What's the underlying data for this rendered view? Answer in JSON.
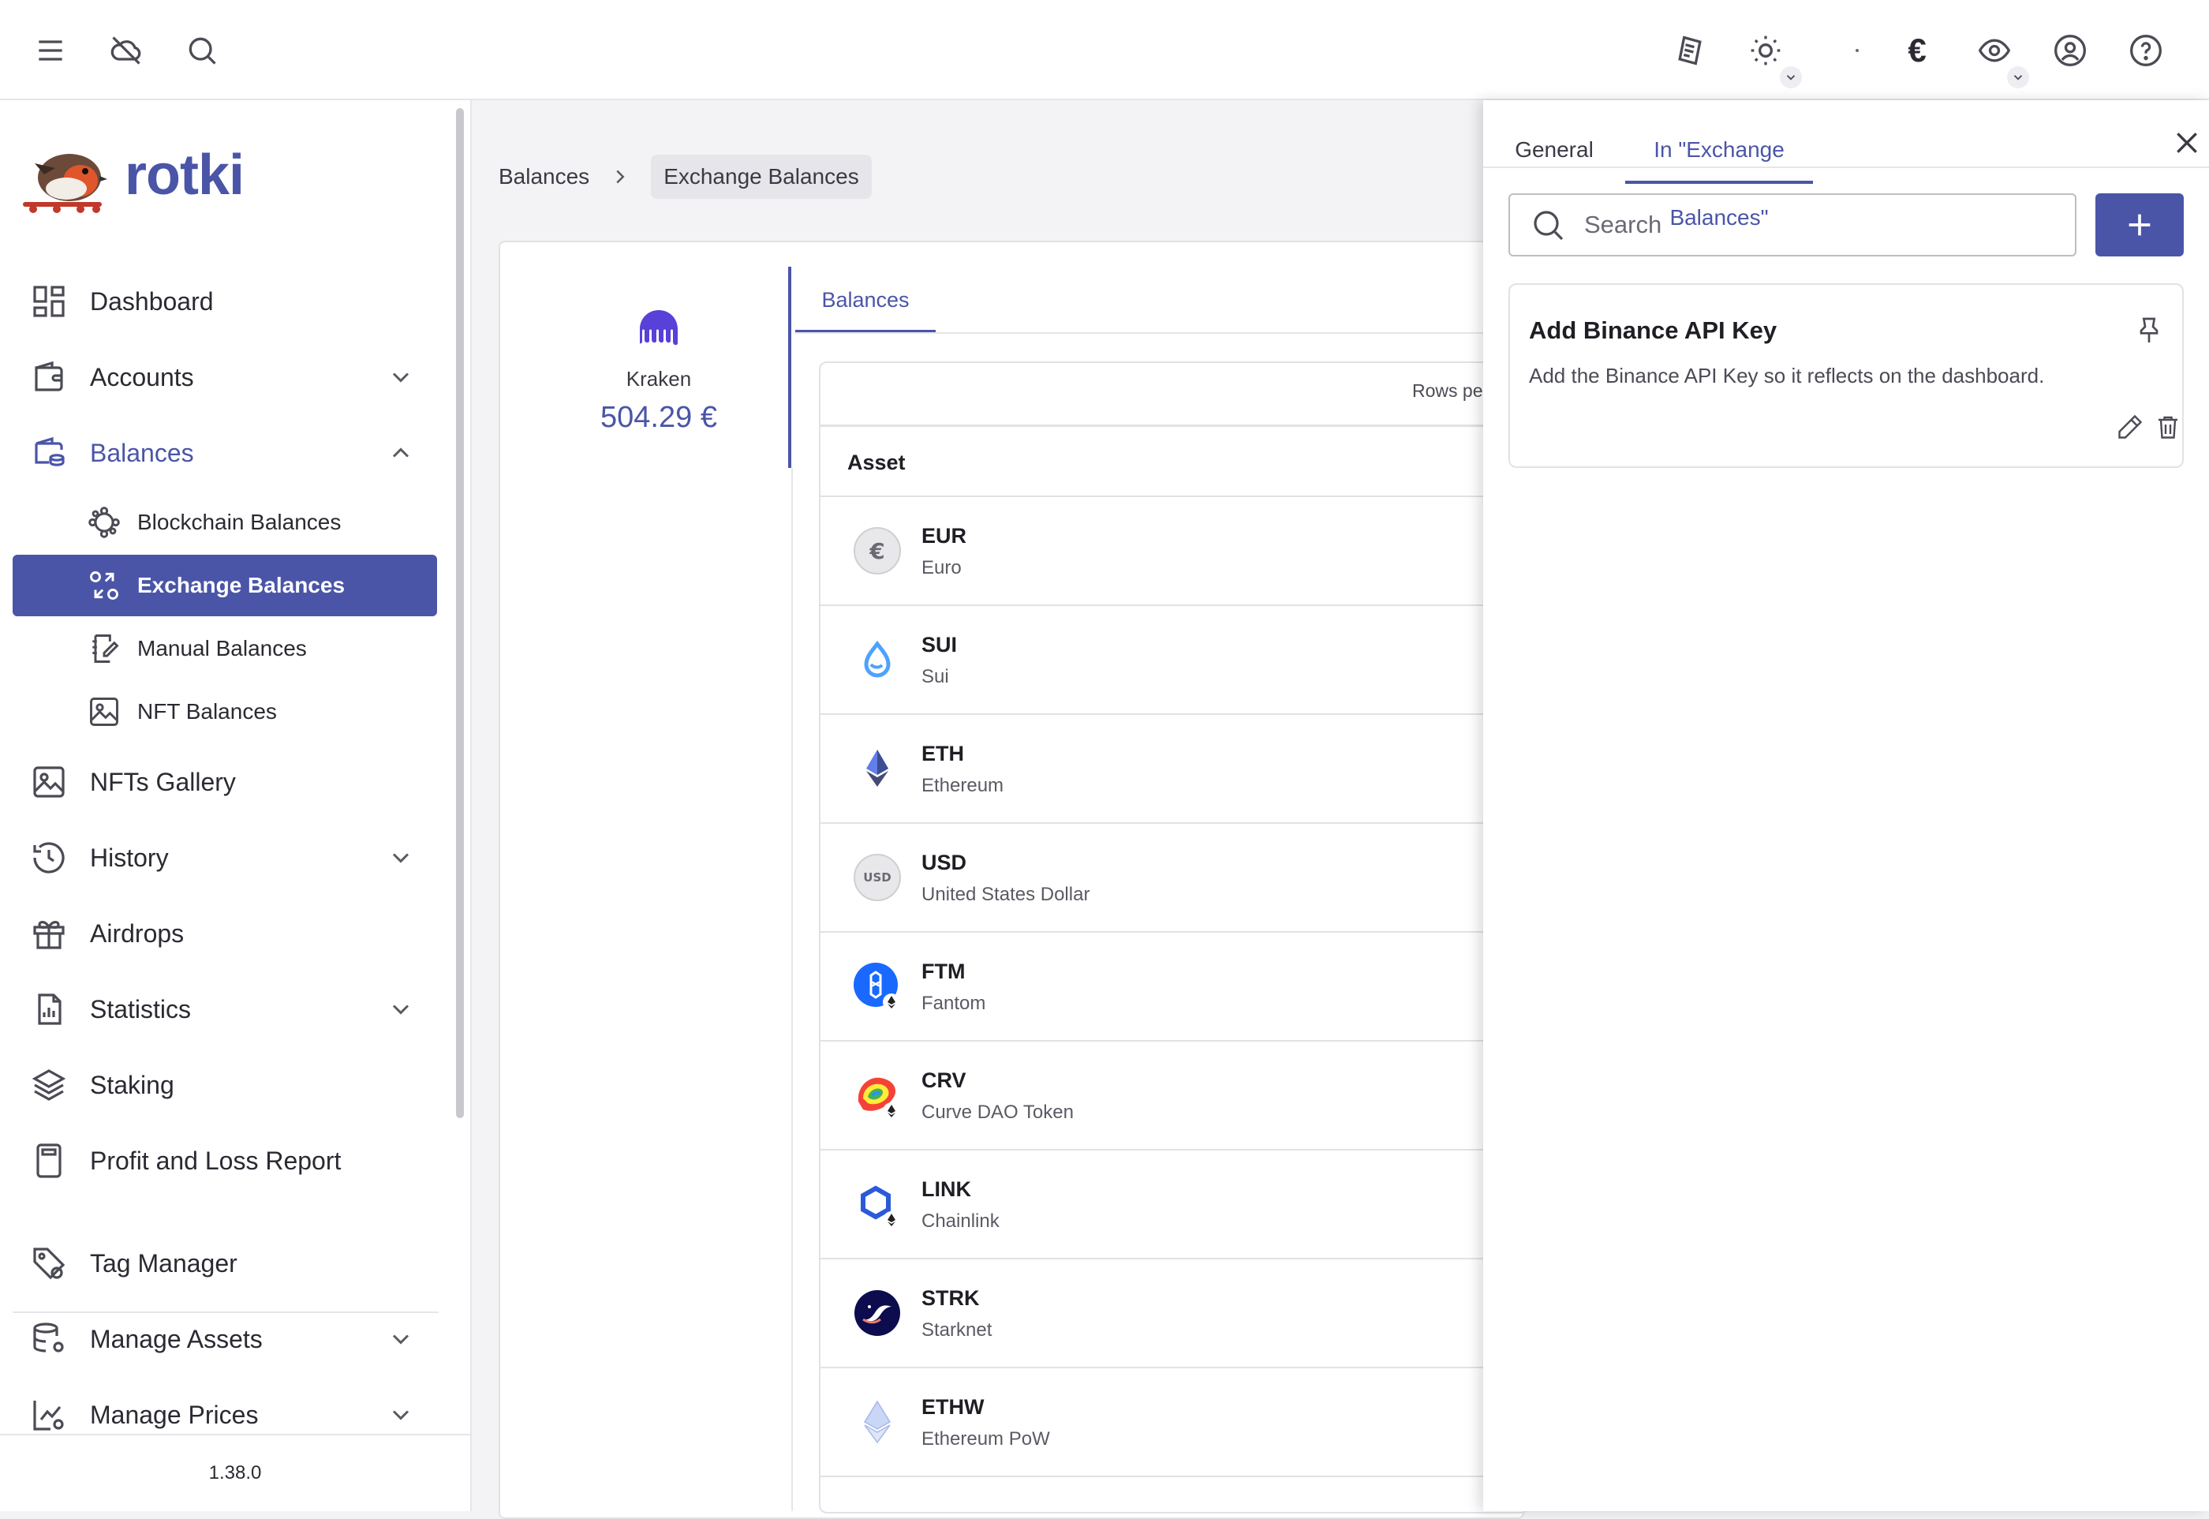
{
  "topbar": {
    "icons": [
      "menu-icon",
      "cloud-off-icon",
      "search-icon",
      "notes-icon",
      "sun-icon",
      "dot-indicator",
      "euro-icon",
      "eye-icon",
      "account-circle-icon",
      "help-icon"
    ],
    "currency_symbol": "€"
  },
  "sidebar": {
    "brand": "rotki",
    "items": [
      {
        "label": "Dashboard"
      },
      {
        "label": "Accounts"
      },
      {
        "label": "Balances"
      },
      {
        "label": "Blockchain Balances"
      },
      {
        "label": "Exchange Balances"
      },
      {
        "label": "Manual Balances"
      },
      {
        "label": "NFT Balances"
      },
      {
        "label": "NFTs Gallery"
      },
      {
        "label": "History"
      },
      {
        "label": "Airdrops"
      },
      {
        "label": "Statistics"
      },
      {
        "label": "Staking"
      },
      {
        "label": "Profit and Loss Report"
      },
      {
        "label": "Tag Manager"
      },
      {
        "label": "Manage Assets"
      },
      {
        "label": "Manage Prices"
      }
    ],
    "version": "1.38.0"
  },
  "breadcrumb": {
    "parent": "Balances",
    "current": "Exchange Balances"
  },
  "exchange": {
    "name": "Kraken",
    "value": "504.29 €"
  },
  "balances_tab": "Balances",
  "table": {
    "rows_per_label": "Rows pe",
    "header_asset": "Asset",
    "rows": [
      {
        "symbol": "EUR",
        "name": "Euro",
        "icon": "euro-coin-icon"
      },
      {
        "symbol": "SUI",
        "name": "Sui",
        "icon": "sui-icon"
      },
      {
        "symbol": "ETH",
        "name": "Ethereum",
        "icon": "ethereum-icon"
      },
      {
        "symbol": "USD",
        "name": "United States Dollar",
        "icon": "usd-coin-icon",
        "icon_text": "USD"
      },
      {
        "symbol": "FTM",
        "name": "Fantom",
        "icon": "fantom-icon"
      },
      {
        "symbol": "CRV",
        "name": "Curve DAO Token",
        "icon": "curve-icon"
      },
      {
        "symbol": "LINK",
        "name": "Chainlink",
        "icon": "chainlink-icon"
      },
      {
        "symbol": "STRK",
        "name": "Starknet",
        "icon": "starknet-icon"
      },
      {
        "symbol": "ETHW",
        "name": "Ethereum PoW",
        "icon": "ethereum-pow-icon"
      }
    ]
  },
  "notes_panel": {
    "tabs": [
      "General",
      "In \"Exchange Balances\""
    ],
    "search_placeholder": "Search",
    "note": {
      "title": "Add Binance API Key",
      "body": "Add the Binance API Key so it reflects on the dashboard."
    }
  },
  "colors": {
    "accent": "#4a55a8",
    "selected_bg": "#4a55a8",
    "background": "#f3f3f5"
  }
}
